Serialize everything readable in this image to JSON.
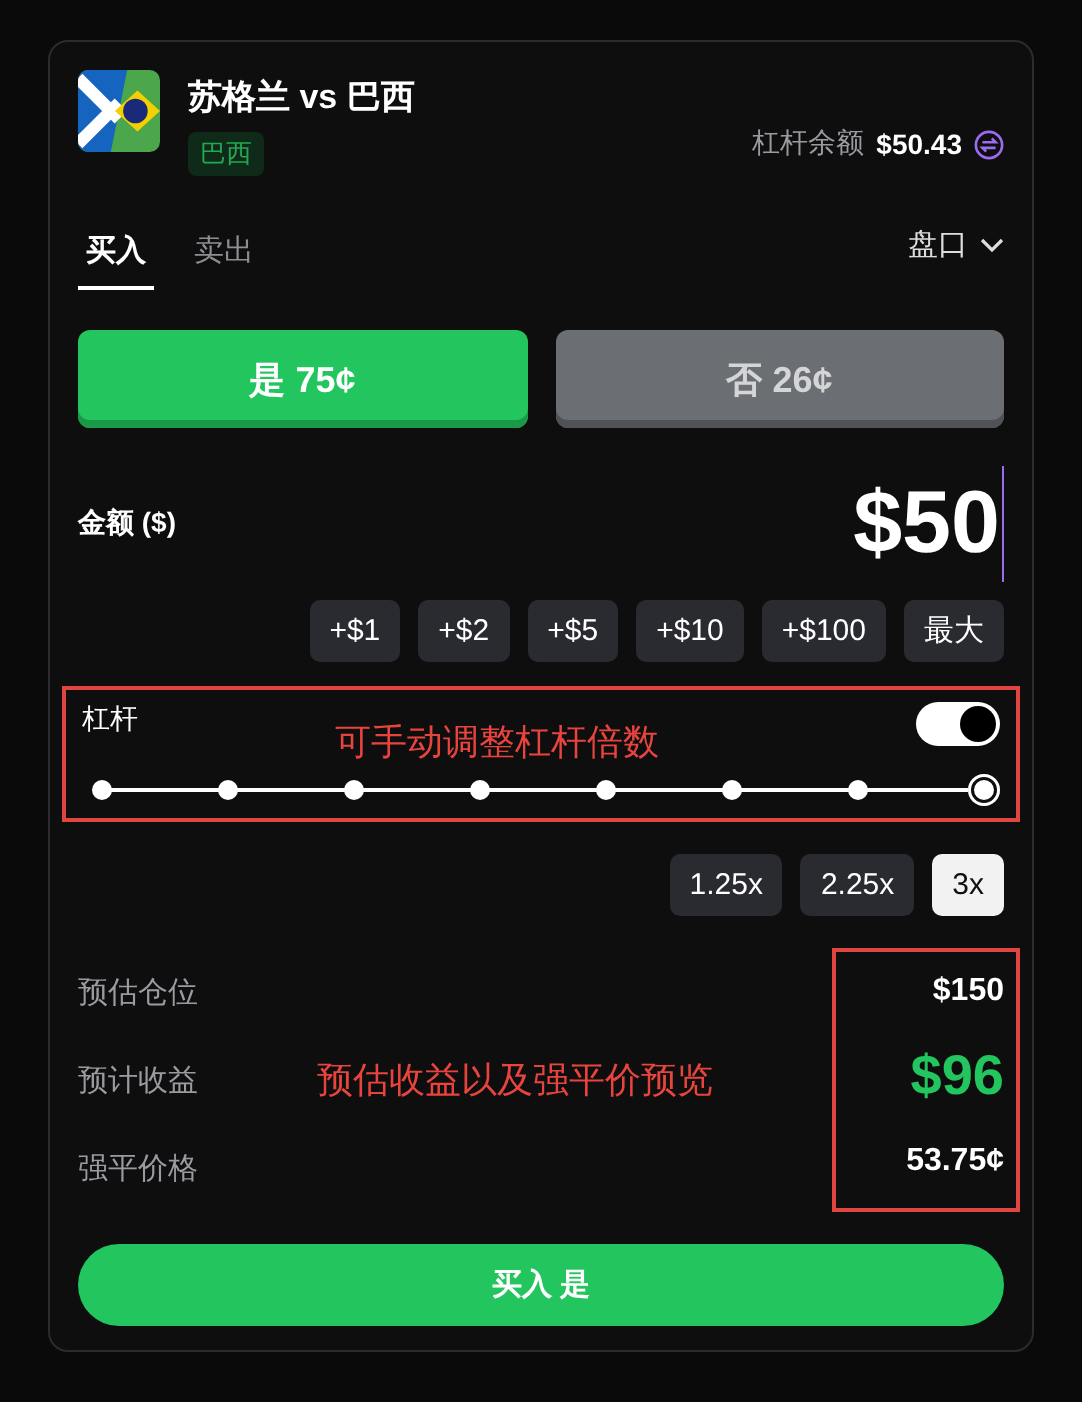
{
  "market": {
    "title": "苏格兰 vs 巴西",
    "tag": "巴西",
    "balance_label": "杠杆余额",
    "balance": "$50.43"
  },
  "tabs": [
    {
      "label": "买入",
      "selected": true
    },
    {
      "label": "卖出",
      "selected": false
    }
  ],
  "market_menu": {
    "label": "盘口"
  },
  "outcomes": [
    {
      "label": "是",
      "price": "75¢",
      "selected": true
    },
    {
      "label": "否",
      "price": "26¢",
      "selected": false
    }
  ],
  "amount": {
    "label": "金额 ($)",
    "value": "$50"
  },
  "quick_amounts": [
    "+$1",
    "+$2",
    "+$5",
    "+$10",
    "+$100",
    "最大"
  ],
  "leverage": {
    "label": "杠杆",
    "on": true,
    "level": 1,
    "annotation": "可手动调整杠杆倍数",
    "stops": [
      {
        "selected": false
      },
      {
        "selected": false
      },
      {
        "selected": false
      },
      {
        "selected": false
      },
      {
        "selected": false
      },
      {
        "selected": false
      },
      {
        "selected": false
      },
      {
        "selected": true
      }
    ]
  },
  "multipliers": [
    {
      "label": "1.25x",
      "selected": false
    },
    {
      "label": "2.25x",
      "selected": false
    },
    {
      "label": "3x",
      "selected": true
    }
  ],
  "summary": {
    "annotation": "预估收益以及强平价预览",
    "rows": [
      {
        "kind": "plain",
        "label": "预估仓位",
        "value": "$150"
      },
      {
        "kind": "profit",
        "label": "预计收益",
        "value": "$96"
      },
      {
        "kind": "plain",
        "label": "强平价格",
        "value": "53.75¢"
      }
    ]
  },
  "submit": {
    "label": "买入 是"
  }
}
